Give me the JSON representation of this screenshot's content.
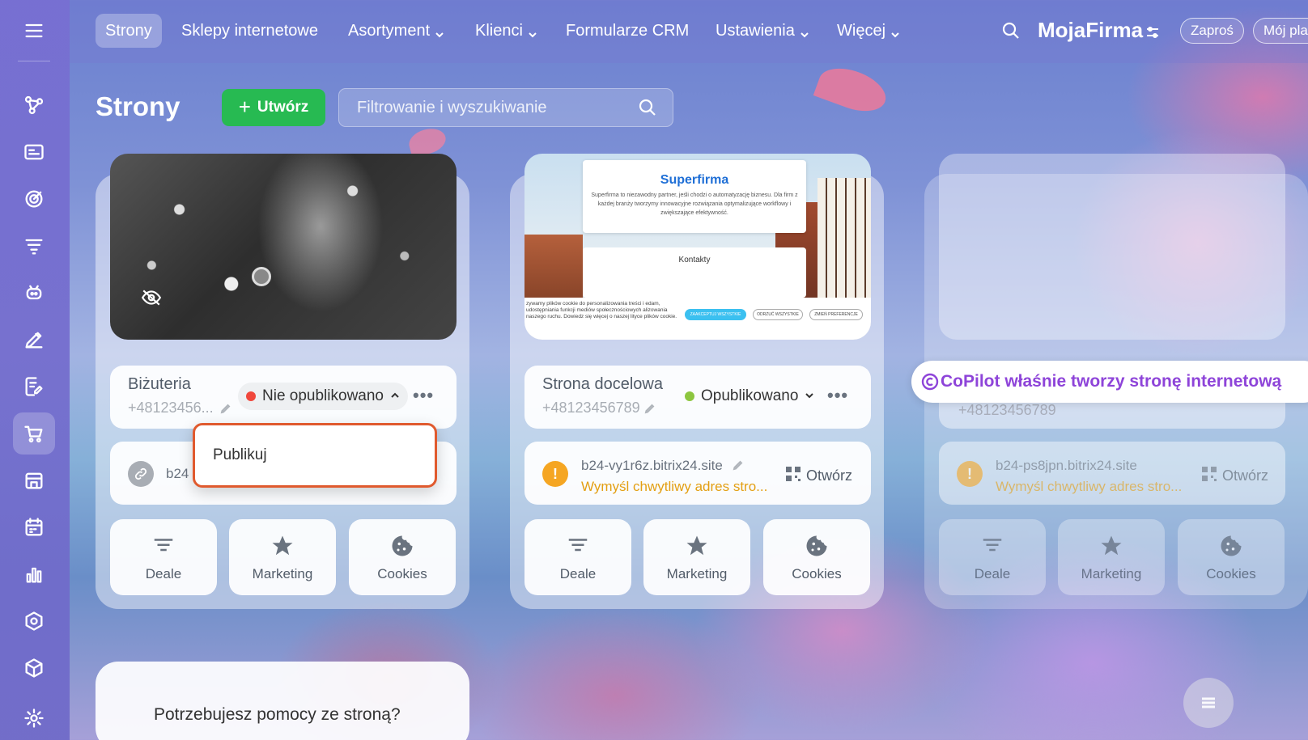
{
  "nav": {
    "items": [
      {
        "label": "Strony",
        "active": true
      },
      {
        "label": "Sklepy internetowe"
      },
      {
        "label": "Asortyment",
        "dropdown": true
      },
      {
        "label": "Klienci",
        "dropdown": true
      },
      {
        "label": "Formularze CRM"
      },
      {
        "label": "Ustawienia",
        "dropdown": true
      },
      {
        "label": "Więcej",
        "dropdown": true
      }
    ],
    "brand": "MojaFirma",
    "invite_label": "Zaproś",
    "plan_label": "Mój pla"
  },
  "page": {
    "title": "Strony",
    "create_label": "Utwórz",
    "search_placeholder": "Filtrowanie i wyszukiwanie"
  },
  "cards": [
    {
      "name": "Biżuteria",
      "phone": "+48123456...",
      "status": "Nie opublikowano",
      "status_color": "#f0473c",
      "url": "b24",
      "dropdown_item": "Publikuj",
      "tiles": [
        "Deale",
        "Marketing",
        "Cookies"
      ]
    },
    {
      "name": "Strona docelowa",
      "phone": "+48123456789",
      "status": "Opublikowano",
      "status_color": "#8dc63f",
      "url": "b24-vy1r6z.bitrix24.site",
      "url_hint": "Wymyśl chwytliwy adres stro...",
      "open_label": "Otwórz",
      "tiles": [
        "Deale",
        "Marketing",
        "Cookies"
      ],
      "preview": {
        "title": "Superfirma",
        "text": "Superfirma to niezawodny partner, jeśli chodzi o automatyzację biznesu. Dla firm z każdej branży tworzymy innowacyjne rozwiązania optymalizujące workflowy i zwiększające efektywność.",
        "contacts": "Kontakty",
        "cookie_text": "zywamy plików cookie do personalizowania treści i edam, udostępniania funkcji mediów społecznościowych alizowania naszego ruchu. Dowiedz się więcej o naszej lityce plików cookie.",
        "btn1": "ZAAKCEPTUJ WSZYSTKIE",
        "btn2": "ODRZUĆ WSZYSTKIE",
        "btn3": "ZMIEŃ PREFERENCJE"
      }
    },
    {
      "phone": "+48123456789",
      "url": "b24-ps8jpn.bitrix24.site",
      "url_hint": "Wymyśl chwytliwy adres stro...",
      "open_label": "Otwórz",
      "tiles": [
        "Deale",
        "Marketing",
        "Cookies"
      ]
    }
  ],
  "copilot_text": "CoPilot właśnie tworzy stronę internetową",
  "help_text": "Potrzebujesz pomocy ze stroną?"
}
